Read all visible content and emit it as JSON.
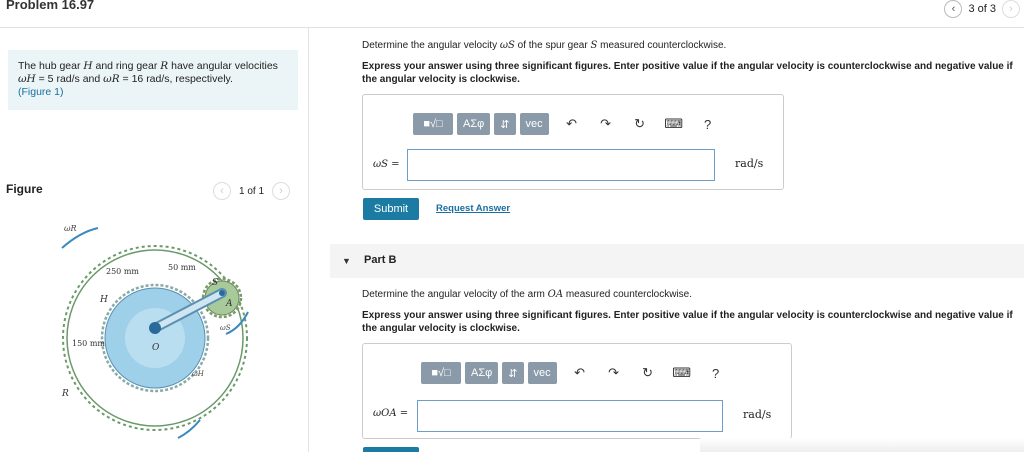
{
  "header": {
    "title": "Problem 16.97",
    "page_indicator": "3 of 3",
    "prev_icon": "chevron-left-icon",
    "next_icon": "chevron-right-icon"
  },
  "intro": {
    "text_1": "The hub gear ",
    "var_H": "H",
    "text_2": " and ring gear ",
    "var_R": "R",
    "text_3": " have angular velocities",
    "omega_H": "ωH",
    "val_H": " = 5 rad/s",
    "and": " and ",
    "omega_R": "ωR",
    "val_R": " = 16 rad/s",
    "text_4": ", respectively.",
    "figure_link": "(Figure 1)"
  },
  "figure": {
    "label": "Figure",
    "pager": "1 of 1",
    "label_omegaR": "ωR",
    "label_250": "250 mm",
    "label_50": "50 mm",
    "label_H": "H",
    "label_S": "S",
    "label_A": "A",
    "label_150": "150 mm",
    "label_O": "O",
    "label_omegaS": "ωS",
    "label_omegaH": "ωH",
    "label_R": "R"
  },
  "partA": {
    "prompt_1": "Determine the angular velocity ",
    "prompt_var": "ωS",
    "prompt_2": " of the spur gear ",
    "prompt_S": "S",
    "prompt_3": " measured counterclockwise.",
    "instruction": "Express your answer using three significant figures. Enter positive value if the angular velocity is counterclockwise and negative value if the angular velocity is clockwise.",
    "answer_label": "ωS =",
    "answer_value": "",
    "unit": "rad/s",
    "submit": "Submit",
    "request": "Request Answer"
  },
  "toolbar": {
    "templates_icon": "templates-icon",
    "greek": "ΑΣφ",
    "arrows": "⇵",
    "vec": "vec",
    "undo_icon": "undo-icon",
    "redo_icon": "redo-icon",
    "reset_icon": "reset-icon",
    "keyboard_icon": "keyboard-icon",
    "help": "?"
  },
  "partB": {
    "label": "Part B",
    "prompt_1": "Determine the angular velocity of the arm ",
    "prompt_var": "OA",
    "prompt_2": " measured counterclockwise.",
    "instruction": "Express your answer using three significant figures. Enter positive value if the angular velocity is counterclockwise and negative value if the angular velocity is clockwise.",
    "answer_label": "ωOA =",
    "answer_value": "",
    "unit": "rad/s"
  },
  "colors": {
    "accent": "#1b7ba3",
    "intro_bg": "#ebf5f7",
    "hub_gear": "#9fd0ea",
    "spur_gear": "#a8c99a"
  }
}
